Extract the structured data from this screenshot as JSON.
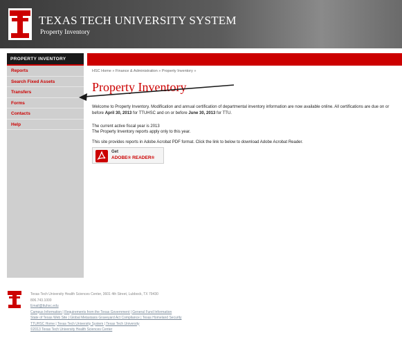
{
  "header": {
    "title": "TEXAS TECH UNIVERSITY SYSTEM",
    "subtitle": "Property Inventory"
  },
  "sidebar": {
    "heading": "PROPERTY INVENTORY",
    "items": [
      {
        "label": "Reports"
      },
      {
        "label": "Search Fixed Assets"
      },
      {
        "label": "Transfers"
      },
      {
        "label": "Forms"
      },
      {
        "label": "Contacts"
      },
      {
        "label": "Help"
      }
    ]
  },
  "breadcrumb": "HSC Home  »  Finance & Administration  »  Property Inventory  »",
  "page_title": "Property Inventory",
  "welcome": {
    "text1": "Welcome to Property Inventory. Modification and annual certification of departmental inventory information are now available online. All certifications are due on or before ",
    "date1": "April 30, 2013",
    "text2": " for TTUHSC and on or before ",
    "date2": "June 30, 2013",
    "text3": " for TTU."
  },
  "fiscal": {
    "line1": "The current active fiscal year is 2013",
    "line2": "The Property Inventory reports apply only to this year."
  },
  "acrobat_note": "This site provides reports in Adobe Acrobat PDF format.  Click the link to below to download Adobe Acrobat Reader.",
  "acrobat_button": {
    "get": "Get",
    "name": "ADOBE® READER®"
  },
  "footer": {
    "address": "Texas Tech University Health Sciences Center, 3601 4th Street, Lubbock, TX 79430",
    "phone": "806.743.1000",
    "email": "Email@ttuhsc.edu",
    "links1": "Campus Information | Requirements from the Texas Government | General Fund Information",
    "links2": "State of Texas Web Site | Global Metastasis Graveyard Act Compliance | Texas Homeland Security",
    "links3": "TTUHSC Home | Texas Tech University System | Texas Tech University",
    "copyright": "©2013 Texas Tech University Health Sciences Center"
  },
  "colors": {
    "brand_red": "#cc0000",
    "header_dark": "#3a3a3a",
    "sidebar_bg": "#cfcfcf"
  },
  "icons": {
    "logo": "double-t-logo",
    "pdf": "adobe-pdf-icon",
    "annotation": "arrow-annotation"
  }
}
